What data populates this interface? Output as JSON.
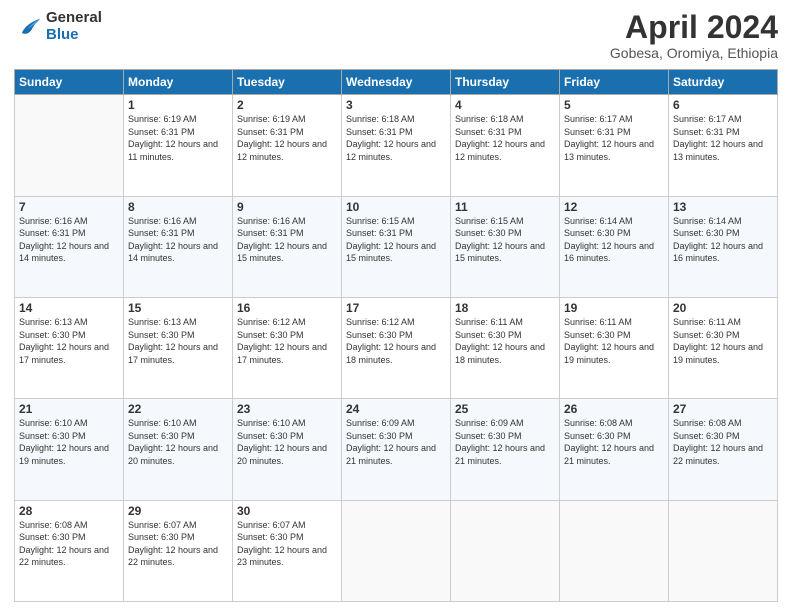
{
  "logo": {
    "line1": "General",
    "line2": "Blue"
  },
  "title": "April 2024",
  "location": "Gobesa, Oromiya, Ethiopia",
  "header_days": [
    "Sunday",
    "Monday",
    "Tuesday",
    "Wednesday",
    "Thursday",
    "Friday",
    "Saturday"
  ],
  "weeks": [
    [
      {
        "day": "",
        "sunrise": "",
        "sunset": "",
        "daylight": ""
      },
      {
        "day": "1",
        "sunrise": "6:19 AM",
        "sunset": "6:31 PM",
        "daylight": "12 hours and 11 minutes."
      },
      {
        "day": "2",
        "sunrise": "6:19 AM",
        "sunset": "6:31 PM",
        "daylight": "12 hours and 12 minutes."
      },
      {
        "day": "3",
        "sunrise": "6:18 AM",
        "sunset": "6:31 PM",
        "daylight": "12 hours and 12 minutes."
      },
      {
        "day": "4",
        "sunrise": "6:18 AM",
        "sunset": "6:31 PM",
        "daylight": "12 hours and 12 minutes."
      },
      {
        "day": "5",
        "sunrise": "6:17 AM",
        "sunset": "6:31 PM",
        "daylight": "12 hours and 13 minutes."
      },
      {
        "day": "6",
        "sunrise": "6:17 AM",
        "sunset": "6:31 PM",
        "daylight": "12 hours and 13 minutes."
      }
    ],
    [
      {
        "day": "7",
        "sunrise": "6:16 AM",
        "sunset": "6:31 PM",
        "daylight": "12 hours and 14 minutes."
      },
      {
        "day": "8",
        "sunrise": "6:16 AM",
        "sunset": "6:31 PM",
        "daylight": "12 hours and 14 minutes."
      },
      {
        "day": "9",
        "sunrise": "6:16 AM",
        "sunset": "6:31 PM",
        "daylight": "12 hours and 15 minutes."
      },
      {
        "day": "10",
        "sunrise": "6:15 AM",
        "sunset": "6:31 PM",
        "daylight": "12 hours and 15 minutes."
      },
      {
        "day": "11",
        "sunrise": "6:15 AM",
        "sunset": "6:30 PM",
        "daylight": "12 hours and 15 minutes."
      },
      {
        "day": "12",
        "sunrise": "6:14 AM",
        "sunset": "6:30 PM",
        "daylight": "12 hours and 16 minutes."
      },
      {
        "day": "13",
        "sunrise": "6:14 AM",
        "sunset": "6:30 PM",
        "daylight": "12 hours and 16 minutes."
      }
    ],
    [
      {
        "day": "14",
        "sunrise": "6:13 AM",
        "sunset": "6:30 PM",
        "daylight": "12 hours and 17 minutes."
      },
      {
        "day": "15",
        "sunrise": "6:13 AM",
        "sunset": "6:30 PM",
        "daylight": "12 hours and 17 minutes."
      },
      {
        "day": "16",
        "sunrise": "6:12 AM",
        "sunset": "6:30 PM",
        "daylight": "12 hours and 17 minutes."
      },
      {
        "day": "17",
        "sunrise": "6:12 AM",
        "sunset": "6:30 PM",
        "daylight": "12 hours and 18 minutes."
      },
      {
        "day": "18",
        "sunrise": "6:11 AM",
        "sunset": "6:30 PM",
        "daylight": "12 hours and 18 minutes."
      },
      {
        "day": "19",
        "sunrise": "6:11 AM",
        "sunset": "6:30 PM",
        "daylight": "12 hours and 19 minutes."
      },
      {
        "day": "20",
        "sunrise": "6:11 AM",
        "sunset": "6:30 PM",
        "daylight": "12 hours and 19 minutes."
      }
    ],
    [
      {
        "day": "21",
        "sunrise": "6:10 AM",
        "sunset": "6:30 PM",
        "daylight": "12 hours and 19 minutes."
      },
      {
        "day": "22",
        "sunrise": "6:10 AM",
        "sunset": "6:30 PM",
        "daylight": "12 hours and 20 minutes."
      },
      {
        "day": "23",
        "sunrise": "6:10 AM",
        "sunset": "6:30 PM",
        "daylight": "12 hours and 20 minutes."
      },
      {
        "day": "24",
        "sunrise": "6:09 AM",
        "sunset": "6:30 PM",
        "daylight": "12 hours and 21 minutes."
      },
      {
        "day": "25",
        "sunrise": "6:09 AM",
        "sunset": "6:30 PM",
        "daylight": "12 hours and 21 minutes."
      },
      {
        "day": "26",
        "sunrise": "6:08 AM",
        "sunset": "6:30 PM",
        "daylight": "12 hours and 21 minutes."
      },
      {
        "day": "27",
        "sunrise": "6:08 AM",
        "sunset": "6:30 PM",
        "daylight": "12 hours and 22 minutes."
      }
    ],
    [
      {
        "day": "28",
        "sunrise": "6:08 AM",
        "sunset": "6:30 PM",
        "daylight": "12 hours and 22 minutes."
      },
      {
        "day": "29",
        "sunrise": "6:07 AM",
        "sunset": "6:30 PM",
        "daylight": "12 hours and 22 minutes."
      },
      {
        "day": "30",
        "sunrise": "6:07 AM",
        "sunset": "6:30 PM",
        "daylight": "12 hours and 23 minutes."
      },
      {
        "day": "",
        "sunrise": "",
        "sunset": "",
        "daylight": ""
      },
      {
        "day": "",
        "sunrise": "",
        "sunset": "",
        "daylight": ""
      },
      {
        "day": "",
        "sunrise": "",
        "sunset": "",
        "daylight": ""
      },
      {
        "day": "",
        "sunrise": "",
        "sunset": "",
        "daylight": ""
      }
    ]
  ]
}
